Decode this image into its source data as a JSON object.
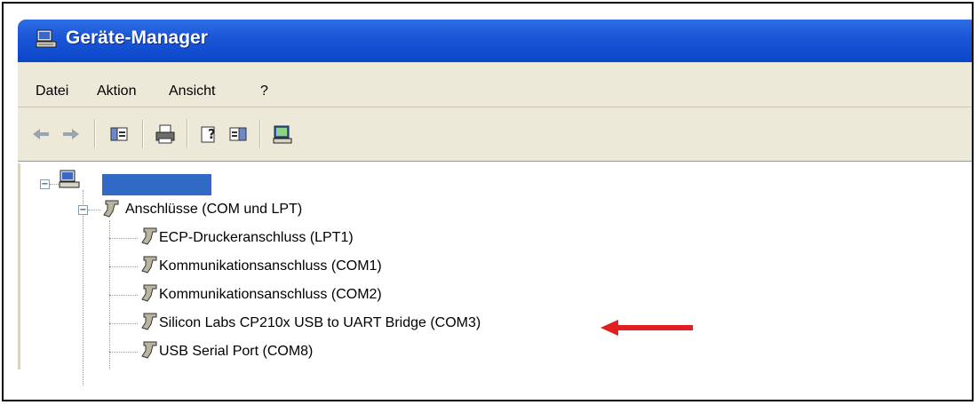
{
  "window": {
    "title": "Geräte-Manager"
  },
  "menu": [
    "Datei",
    "Aktion",
    "Ansicht",
    "?"
  ],
  "tree": {
    "root_label": "",
    "category": "Anschlüsse (COM und LPT)",
    "items": [
      "ECP-Druckeranschluss (LPT1)",
      "Kommunikationsanschluss (COM1)",
      "Kommunikationsanschluss (COM2)",
      "Silicon Labs CP210x USB to UART Bridge (COM3)",
      "USB Serial Port (COM8)"
    ]
  },
  "icons": {
    "title": "computer-icon",
    "toolbar": [
      "back-arrow-icon",
      "forward-arrow-icon",
      "console-tree-icon",
      "print-icon",
      "properties-help-icon",
      "action-pane-icon",
      "scan-hardware-icon"
    ],
    "annotation": "red-arrow-icon"
  },
  "colors": {
    "titlebar": "#0a46c9",
    "selection": "#316ac5",
    "annotation_arrow": "#e31e1e"
  }
}
